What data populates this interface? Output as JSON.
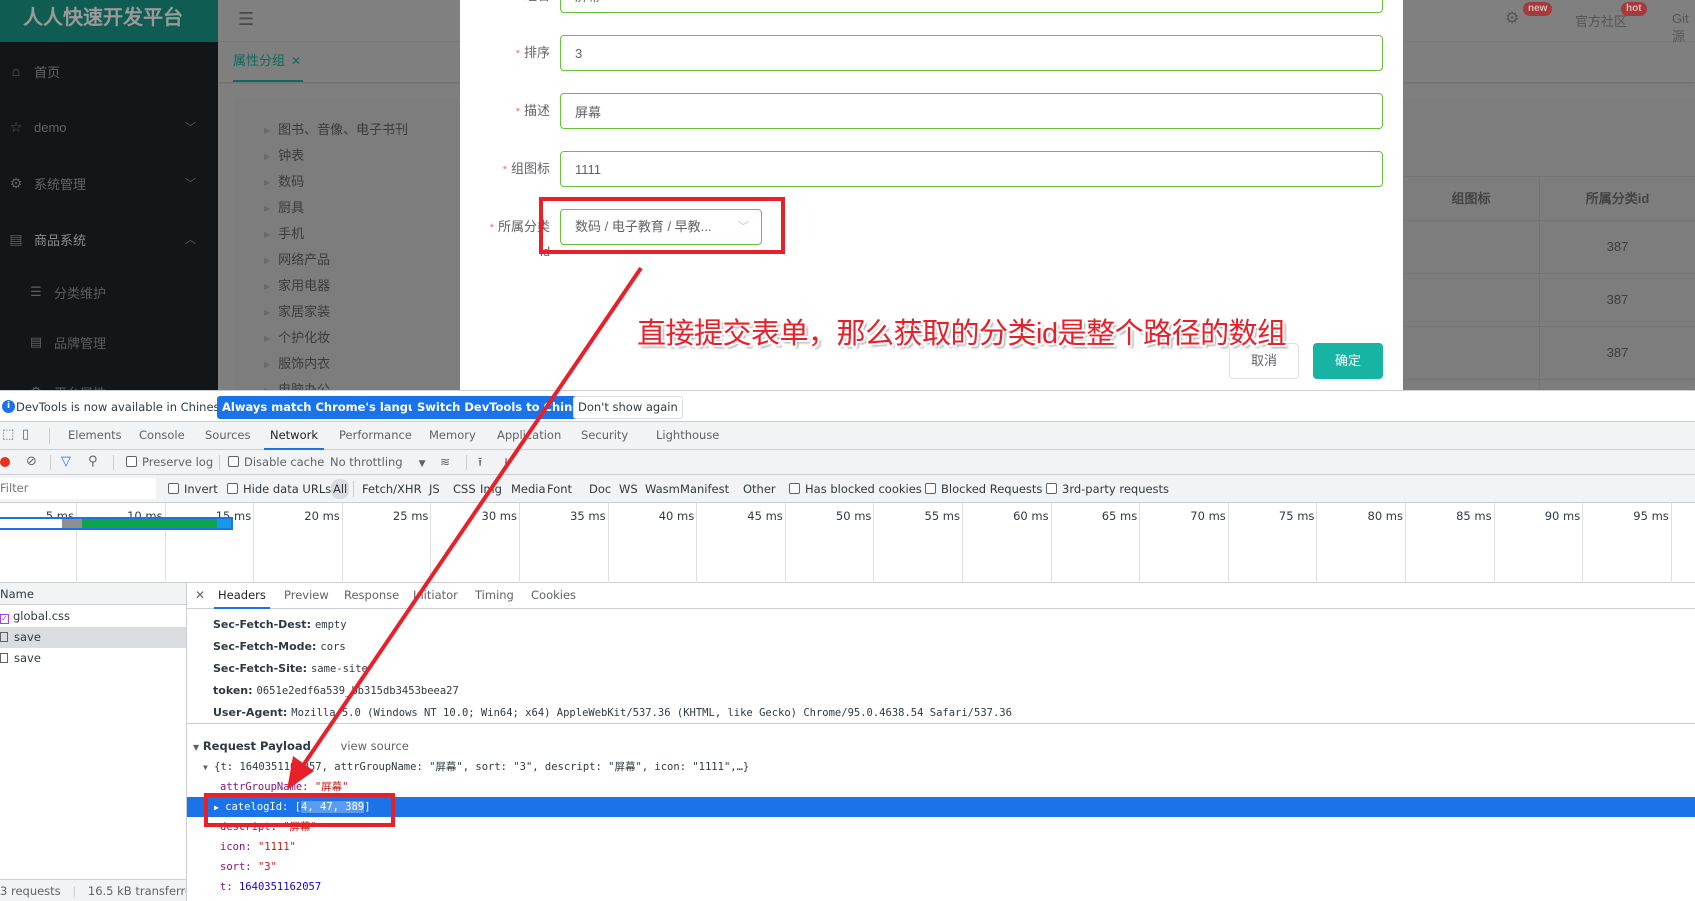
{
  "app": {
    "logo": "人人快速开发平台",
    "sidebar": {
      "items": [
        {
          "label": "首页",
          "icon": "home-icon"
        },
        {
          "label": "demo",
          "icon": "star-icon",
          "expandable": true
        },
        {
          "label": "系统管理",
          "icon": "gear-icon",
          "expandable": true
        },
        {
          "label": "商品系统",
          "icon": "book-icon",
          "expandable": true,
          "open": true
        }
      ],
      "subitems": [
        {
          "label": "分类维护",
          "icon": "list-icon"
        },
        {
          "label": "品牌管理",
          "icon": "book-icon"
        },
        {
          "label": "平台属性",
          "icon": "gear-icon"
        }
      ]
    },
    "navbar": {
      "menu_icon": "hamburger-icon",
      "settings_badge": "new",
      "community": "官方社区",
      "community_badge": "hot",
      "git": "Git源"
    },
    "tabs": [
      {
        "label": "属性分组",
        "active": true
      }
    ],
    "category_tree": [
      "图书、音像、电子书刊",
      "钟表",
      "数码",
      "厨具",
      "手机",
      "网络产品",
      "家用电器",
      "家居家装",
      "个护化妆",
      "服饰内衣",
      "电脑办公"
    ],
    "table": {
      "headers": [
        "组图标",
        "所属分类id"
      ],
      "rows": [
        [
          "",
          "387"
        ],
        [
          "",
          "387"
        ],
        [
          "",
          "387"
        ]
      ]
    }
  },
  "dialog": {
    "fields": [
      {
        "label": "组名",
        "value": "屏幕",
        "required": true
      },
      {
        "label": "排序",
        "value": "3",
        "required": true
      },
      {
        "label": "描述",
        "value": "屏幕",
        "required": true
      },
      {
        "label": "组图标",
        "value": "1111",
        "required": true
      }
    ],
    "category_field": {
      "label": "所属分类",
      "label_line2": "id",
      "value": "数码 / 电子教育 / 早教...",
      "required": true
    },
    "cancel": "取消",
    "confirm": "确定"
  },
  "annotation": {
    "text": "直接提交表单，那么获取的分类id是整个路径的数组",
    "color": "#e8202a"
  },
  "devtools": {
    "infobar": {
      "text": "DevTools is now available in Chinese!",
      "btn_match": "Always match Chrome's language",
      "btn_switch": "Switch DevTools to Chinese",
      "btn_dismiss": "Don't show again"
    },
    "tabs": [
      "Elements",
      "Console",
      "Sources",
      "Network",
      "Performance",
      "Memory",
      "Application",
      "Security",
      "Lighthouse"
    ],
    "active_tab": "Network",
    "toolbar": {
      "preserve_log": "Preserve log",
      "disable_cache": "Disable cache",
      "throttling": "No throttling"
    },
    "filter": {
      "placeholder": "Filter",
      "invert": "Invert",
      "hide_data_urls": "Hide data URLs",
      "types": [
        "All",
        "Fetch/XHR",
        "JS",
        "CSS",
        "Img",
        "Media",
        "Font",
        "Doc",
        "WS",
        "Wasm",
        "Manifest",
        "Other"
      ],
      "has_blocked_cookies": "Has blocked cookies",
      "blocked_requests": "Blocked Requests",
      "third_party": "3rd-party requests"
    },
    "timeline_ticks": [
      "5 ms",
      "10 ms",
      "15 ms",
      "20 ms",
      "25 ms",
      "30 ms",
      "35 ms",
      "40 ms",
      "45 ms",
      "50 ms",
      "55 ms",
      "60 ms",
      "65 ms",
      "70 ms",
      "75 ms",
      "80 ms",
      "85 ms",
      "90 ms",
      "95 ms"
    ],
    "requests": {
      "header": "Name",
      "rows": [
        "global.css",
        "save",
        "save"
      ],
      "status": "3 requests",
      "transferred": "16.5 kB transferred"
    },
    "details": {
      "tabs": [
        "Headers",
        "Preview",
        "Response",
        "Initiator",
        "Timing",
        "Cookies"
      ],
      "active_tab": "Headers",
      "headers": [
        {
          "key": "Sec-Fetch-Dest:",
          "value": "empty"
        },
        {
          "key": "Sec-Fetch-Mode:",
          "value": "cors"
        },
        {
          "key": "Sec-Fetch-Site:",
          "value": "same-site"
        },
        {
          "key": "token:",
          "value": "0651e2edf6a539_bb315db3453beea27"
        },
        {
          "key": "User-Agent:",
          "value": "Mozilla/5.0 (Windows NT 10.0; Win64; x64) AppleWebKit/537.36 (KHTML, like Gecko) Chrome/95.0.4638.54 Safari/537.36"
        }
      ],
      "payload_title": "Request Payload",
      "view_source": "view source",
      "payload_summary": "{t: 1640351162057, attrGroupName: \"屏幕\", sort: \"3\", descript: \"屏幕\", icon: \"1111\",…}",
      "payload": {
        "attrGroupName_key": "attrGroupName:",
        "attrGroupName_val": "\"屏幕\"",
        "catelogId_key": "catelogId:",
        "catelogId_open": "[",
        "catelogId_val": "4, 47, 389",
        "catelogId_close": "]",
        "descript_key": "descript:",
        "descript_val": "\"屏幕\"",
        "icon_key": "icon:",
        "icon_val": "\"1111\"",
        "sort_key": "sort:",
        "sort_val": "\"3\"",
        "t_key": "t:",
        "t_val": "1640351162057"
      }
    }
  }
}
